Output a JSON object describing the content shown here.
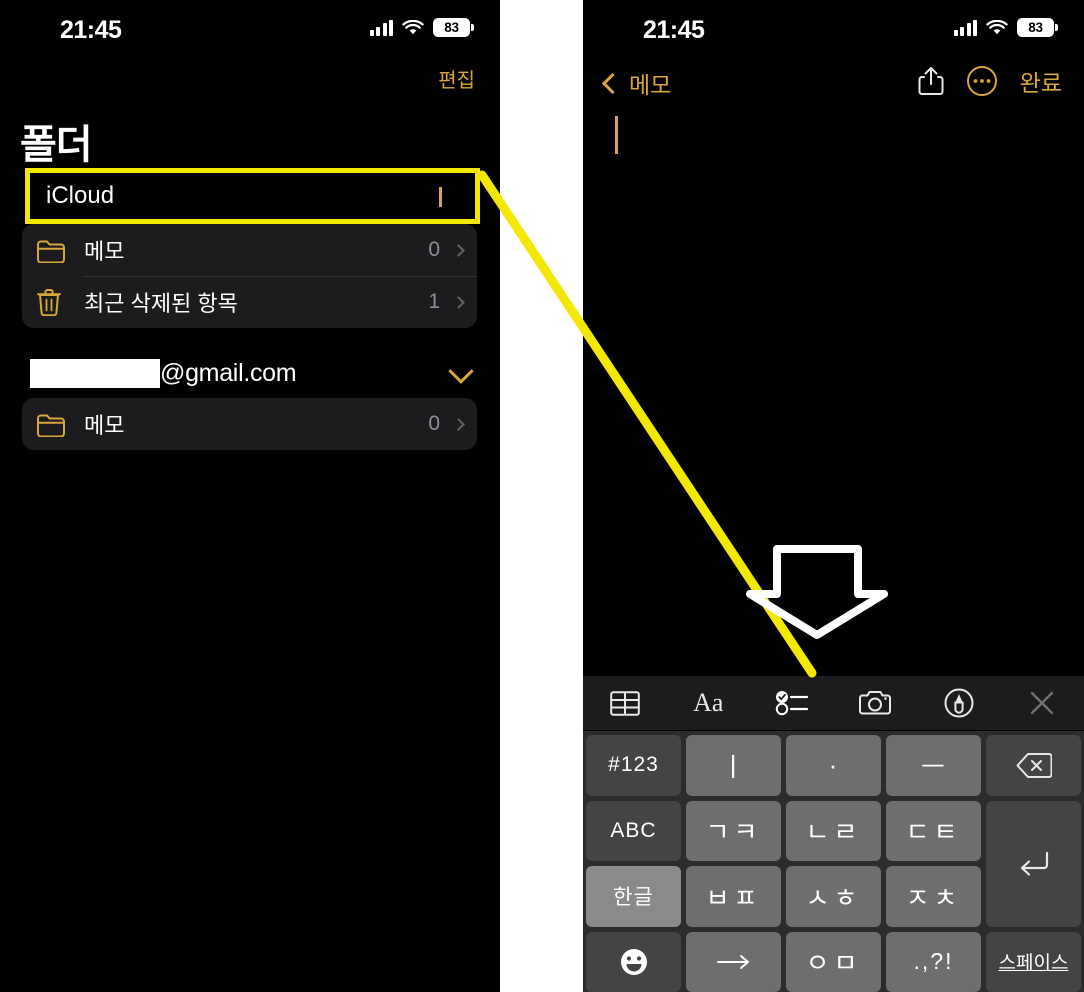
{
  "status_bar": {
    "time": "21:45",
    "battery_level": "83",
    "cellular_icon": "cellular-bars-icon",
    "wifi_icon": "wifi-icon",
    "battery_icon": "battery-icon"
  },
  "folders_screen": {
    "edit_label": "편집",
    "title": "폴더",
    "accounts": [
      {
        "name": "iCloud",
        "highlighted": true,
        "folders": [
          {
            "icon": "folder-icon",
            "name": "메모",
            "count": "0"
          },
          {
            "icon": "trash-icon",
            "name": "최근 삭제된 항목",
            "count": "1"
          }
        ]
      },
      {
        "name": "@gmail.com",
        "redacted_prefix": true,
        "highlighted": false,
        "folders": [
          {
            "icon": "folder-icon",
            "name": "메모",
            "count": "0"
          }
        ]
      }
    ]
  },
  "note_screen": {
    "back_label": "메모",
    "done_label": "완료",
    "share_icon": "share-icon",
    "more_icon": "more-circle-icon",
    "body_text": "",
    "toolbar": [
      {
        "icon": "table-icon",
        "name": "table-button"
      },
      {
        "icon": "format-aa-icon",
        "name": "format-button",
        "text": "Aa"
      },
      {
        "icon": "checklist-icon",
        "name": "checklist-button",
        "highlighted": true
      },
      {
        "icon": "camera-icon",
        "name": "camera-button"
      },
      {
        "icon": "markup-pen-icon",
        "name": "markup-button"
      },
      {
        "icon": "close-x-icon",
        "name": "close-toolbar-button"
      }
    ]
  },
  "keyboard": {
    "type": "cheonjiin",
    "rows": [
      [
        {
          "label": "#123",
          "style": "dark",
          "name": "key-numbers"
        },
        {
          "label": "ㅣ",
          "style": "light",
          "name": "key-vowel-i"
        },
        {
          "label": "·",
          "style": "light",
          "name": "key-vowel-dot"
        },
        {
          "label": "ㅡ",
          "style": "light",
          "name": "key-vowel-eu"
        },
        {
          "label": "⌫",
          "style": "dark",
          "name": "key-backspace"
        }
      ],
      [
        {
          "label": "ABC",
          "style": "dark",
          "name": "key-abc"
        },
        {
          "label": "ㄱㅋ",
          "style": "light",
          "name": "key-giyeok-kieuk"
        },
        {
          "label": "ㄴㄹ",
          "style": "light",
          "name": "key-nieun-rieul"
        },
        {
          "label": "ㄷㅌ",
          "style": "light",
          "name": "key-digeut-tieut"
        },
        {
          "label": "↵",
          "style": "dark",
          "name": "key-return",
          "span": 2
        }
      ],
      [
        {
          "label": "한글",
          "style": "sel",
          "name": "key-hangul"
        },
        {
          "label": "ㅂㅍ",
          "style": "light",
          "name": "key-bieup-pieup"
        },
        {
          "label": "ㅅㅎ",
          "style": "light",
          "name": "key-siot-hieut"
        },
        {
          "label": "ㅈㅊ",
          "style": "light",
          "name": "key-jieut-chieut"
        }
      ],
      [
        {
          "label": "😀",
          "style": "dark",
          "name": "key-emoji"
        },
        {
          "label": "→",
          "style": "light",
          "name": "key-arrow-right"
        },
        {
          "label": "ㅇㅁ",
          "style": "light",
          "name": "key-ieung-mieum"
        },
        {
          "label": ".,?!",
          "style": "light",
          "name": "key-punctuation"
        },
        {
          "label": "스페이스",
          "style": "dark",
          "name": "key-space"
        }
      ]
    ]
  },
  "annotations": {
    "highlight_color": "#f5e800",
    "arrow_color": "#ffffff",
    "callout_line": "connects iCloud account row to checklist toolbar button",
    "down_arrow": "points at checklist button"
  }
}
